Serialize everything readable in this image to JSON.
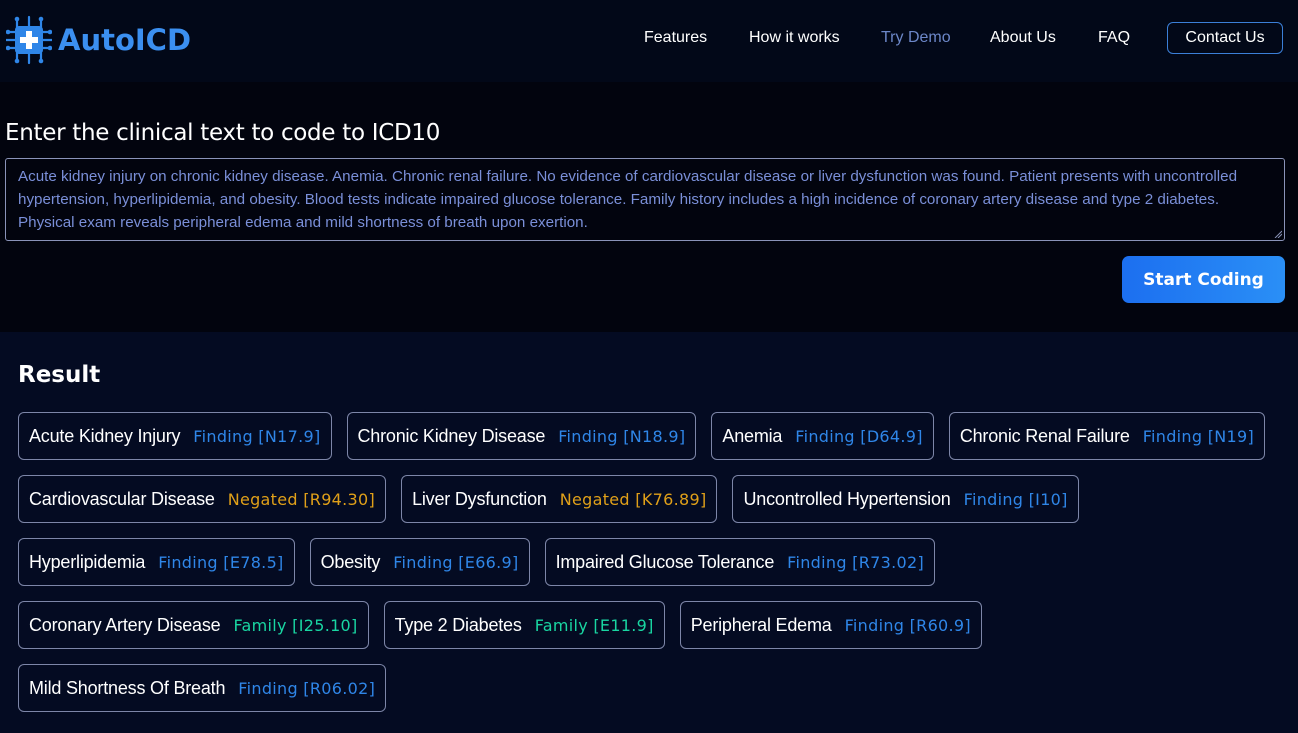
{
  "header": {
    "logo_text": "AutoICD",
    "nav": [
      {
        "label": "Features",
        "active": false
      },
      {
        "label": "How it works",
        "active": false
      },
      {
        "label": "Try Demo",
        "active": true
      },
      {
        "label": "About Us",
        "active": false
      },
      {
        "label": "FAQ",
        "active": false
      }
    ],
    "contact_label": "Contact Us"
  },
  "input": {
    "title": "Enter the clinical text to code to ICD10",
    "clinical_text": "Acute kidney injury on chronic kidney disease. Anemia. Chronic renal failure. No evidence of cardiovascular disease or liver dysfunction was found. Patient presents with uncontrolled hypertension, hyperlipidemia, and obesity. Blood tests indicate impaired glucose tolerance. Family history includes a high incidence of coronary artery disease and type 2 diabetes. Physical exam reveals peripheral edema and mild shortness of breath upon exertion.",
    "start_label": "Start Coding"
  },
  "result": {
    "title": "Result",
    "rows": [
      [
        {
          "name": "Acute Kidney Injury",
          "status": "Finding",
          "code": "N17.9"
        },
        {
          "name": "Chronic Kidney Disease",
          "status": "Finding",
          "code": "N18.9"
        },
        {
          "name": "Anemia",
          "status": "Finding",
          "code": "D64.9"
        },
        {
          "name": "Chronic Renal Failure",
          "status": "Finding",
          "code": "N19"
        }
      ],
      [
        {
          "name": "Cardiovascular Disease",
          "status": "Negated",
          "code": "R94.30"
        },
        {
          "name": "Liver Dysfunction",
          "status": "Negated",
          "code": "K76.89"
        },
        {
          "name": "Uncontrolled Hypertension",
          "status": "Finding",
          "code": "I10"
        }
      ],
      [
        {
          "name": "Hyperlipidemia",
          "status": "Finding",
          "code": "E78.5"
        },
        {
          "name": "Obesity",
          "status": "Finding",
          "code": "E66.9"
        },
        {
          "name": "Impaired Glucose Tolerance",
          "status": "Finding",
          "code": "R73.02"
        }
      ],
      [
        {
          "name": "Coronary Artery Disease",
          "status": "Family",
          "code": "I25.10"
        },
        {
          "name": "Type 2 Diabetes",
          "status": "Family",
          "code": "E11.9"
        },
        {
          "name": "Peripheral Edema",
          "status": "Finding",
          "code": "R60.9"
        }
      ],
      [
        {
          "name": "Mild Shortness Of Breath",
          "status": "Finding",
          "code": "R06.02"
        }
      ]
    ]
  },
  "colors": {
    "finding": "#2f86e8",
    "negated": "#e0a019",
    "family": "#19d6a2",
    "accent": "#3b8ff0"
  }
}
